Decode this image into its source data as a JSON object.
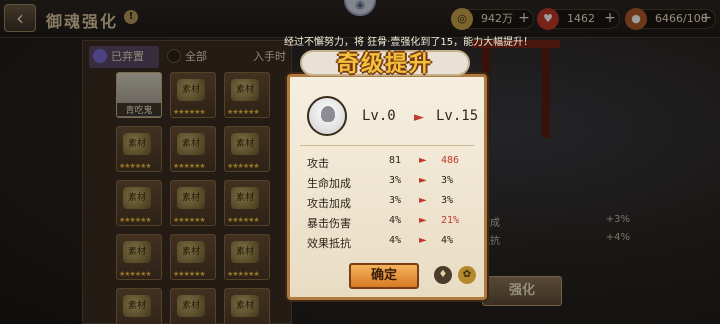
{
  "topbar": {
    "back_icon": "‹",
    "title": "御魂强化",
    "help_icon": "!",
    "resources": [
      {
        "name": "coin",
        "value": "942万",
        "color": "#c9a24a",
        "icon": "coin-icon"
      },
      {
        "name": "stamina",
        "value": "1462",
        "color": "#c0392b",
        "icon": "stamina-icon"
      },
      {
        "name": "orb",
        "value": "6466/100",
        "color": "#b35a2a",
        "icon": "orb-icon"
      }
    ]
  },
  "notice": "经过不懈努力，将 狂骨·壹强化到了15，能力大幅提升！",
  "filters": {
    "equipped": "已弃置",
    "all": "全部",
    "third": "入手时"
  },
  "grid": {
    "special_label": "青吃鬼",
    "cell_glyph": "素材",
    "cell_stars": "★★★★★★"
  },
  "modal": {
    "banner": "奇级提升",
    "level_from": "Lv.0",
    "level_to": "Lv.15",
    "stats": [
      {
        "name": "攻击",
        "from": "81",
        "to": "486",
        "up": true
      },
      {
        "name": "生命加成",
        "from": "3%",
        "to": "3%",
        "up": false
      },
      {
        "name": "攻击加成",
        "from": "3%",
        "to": "3%",
        "up": false
      },
      {
        "name": "暴击伤害",
        "from": "4%",
        "to": "21%",
        "up": true
      },
      {
        "name": "效果抵抗",
        "from": "4%",
        "to": "4%",
        "up": false
      }
    ],
    "confirm": "确定"
  },
  "side": {
    "stats": [
      {
        "name": "加成",
        "value": "+3%"
      },
      {
        "name": "抵抗",
        "value": "+4%"
      }
    ],
    "enhance": "强化"
  }
}
